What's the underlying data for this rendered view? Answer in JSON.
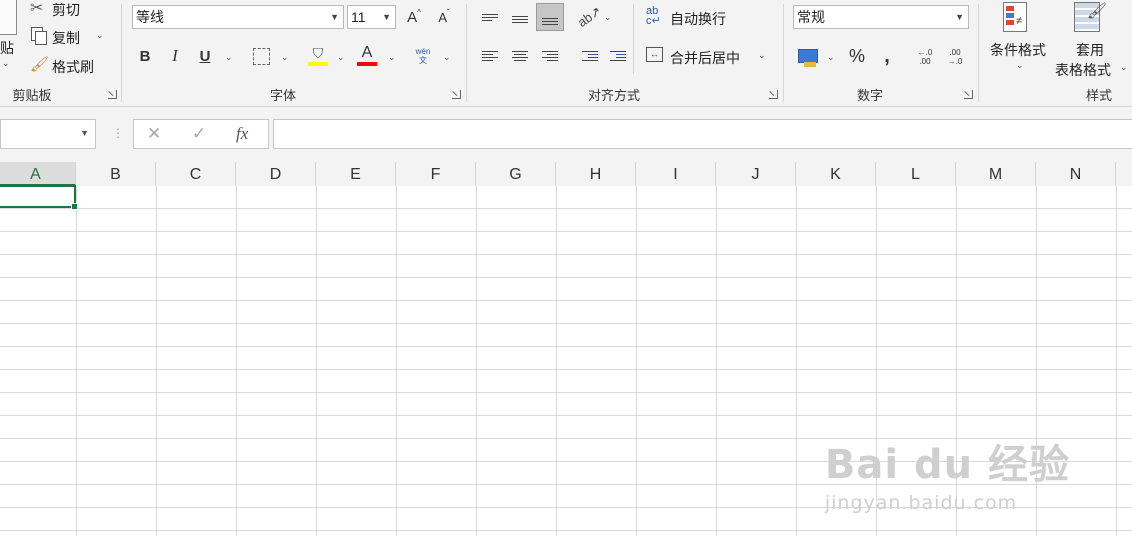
{
  "clipboard": {
    "paste_label": "贴",
    "cut_label": "剪切",
    "copy_label": "复制",
    "format_painter_label": "格式刷",
    "group_label": "剪贴板"
  },
  "font": {
    "name": "等线",
    "size": "11",
    "grow_icon": "A",
    "shrink_icon": "A",
    "bold": "B",
    "italic": "I",
    "underline": "U",
    "phonetic": "wén 文",
    "font_color_glyph": "A",
    "group_label": "字体",
    "highlight_color": "#ffff00",
    "font_color": "#ff0000"
  },
  "alignment": {
    "wrap_text_label": "自动换行",
    "merge_center_label": "合并后居中",
    "group_label": "对齐方式"
  },
  "number": {
    "format": "常规",
    "percent": "%",
    "comma": ",",
    "inc_decimal": "←.0 .00",
    "dec_decimal": ".00 →.0",
    "group_label": "数字"
  },
  "styles": {
    "conditional_format_label": "条件格式",
    "table_format_line1": "套用",
    "table_format_line2": "表格格式",
    "group_label": "样式"
  },
  "formula_bar": {
    "name_box": "",
    "fx": "fx",
    "formula": ""
  },
  "grid": {
    "columns": [
      "A",
      "B",
      "C",
      "D",
      "E",
      "F",
      "G",
      "H",
      "I",
      "J",
      "K",
      "L",
      "M",
      "N"
    ],
    "selected_column": "A",
    "active_cell": "A1",
    "accent": "#217346"
  },
  "watermark": {
    "logo": "Bai du 经验",
    "url": "jingyan.baidu.com"
  }
}
